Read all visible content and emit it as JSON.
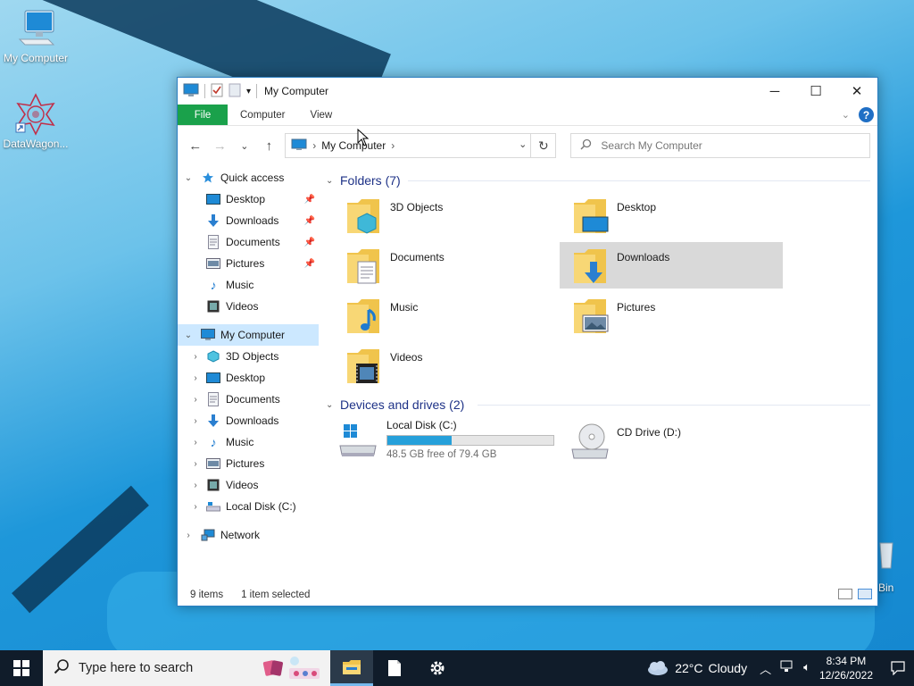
{
  "desktop": {
    "icons": [
      {
        "label": "My Computer",
        "icon": "computer-icon"
      },
      {
        "label": "DataWagon...",
        "icon": "datawagon-shortcut-icon"
      }
    ],
    "recycle_bin_partial_label": "Bin"
  },
  "window": {
    "title": "My Computer",
    "controls": {
      "minimize": "─",
      "maximize": "☐",
      "close": "✕"
    }
  },
  "ribbon": {
    "tabs": [
      "File",
      "Computer",
      "View"
    ],
    "help": "?",
    "file_tab_color": "#1aa14b"
  },
  "navigation": {
    "back": "←",
    "forward": "→",
    "recent": "⌄",
    "up": "↑",
    "address": {
      "location": "My Computer",
      "separator": "›"
    },
    "refresh": "↻",
    "search_placeholder": "Search My Computer"
  },
  "nav_pane": {
    "quick_access": {
      "label": "Quick access",
      "items": [
        {
          "label": "Desktop",
          "pinned": true
        },
        {
          "label": "Downloads",
          "pinned": true
        },
        {
          "label": "Documents",
          "pinned": true
        },
        {
          "label": "Pictures",
          "pinned": true
        },
        {
          "label": "Music",
          "pinned": false
        },
        {
          "label": "Videos",
          "pinned": false
        }
      ]
    },
    "this_pc": {
      "label": "My Computer",
      "selected": true,
      "items": [
        "3D Objects",
        "Desktop",
        "Documents",
        "Downloads",
        "Music",
        "Pictures",
        "Videos",
        "Local Disk (C:)"
      ]
    },
    "network": {
      "label": "Network"
    }
  },
  "content": {
    "folders_header": "Folders (7)",
    "folders": [
      {
        "label": "3D Objects"
      },
      {
        "label": "Desktop"
      },
      {
        "label": "Documents"
      },
      {
        "label": "Downloads",
        "selected": true
      },
      {
        "label": "Music"
      },
      {
        "label": "Pictures"
      },
      {
        "label": "Videos"
      }
    ],
    "devices_header": "Devices and drives (2)",
    "drives": [
      {
        "label": "Local Disk (C:)",
        "free_text": "48.5 GB free of 79.4 GB",
        "used_fraction": 0.389
      },
      {
        "label": "CD Drive (D:)"
      }
    ]
  },
  "status": {
    "item_count": "9 items",
    "selection": "1 item selected"
  },
  "taskbar": {
    "search_placeholder": "Type here to search",
    "weather": {
      "temp": "22°C",
      "condition": "Cloudy"
    },
    "time": "8:34 PM",
    "date": "12/26/2022"
  }
}
